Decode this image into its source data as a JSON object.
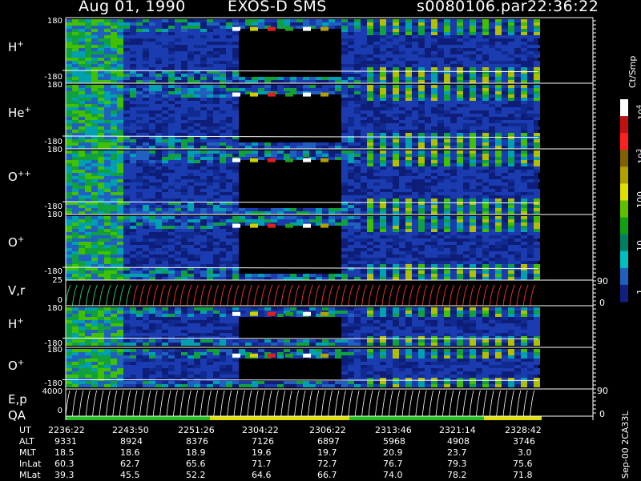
{
  "header": {
    "date": "Aug 01, 1990",
    "instrument": "EXOS-D SMS",
    "file": "s0080106.par",
    "time": "22:36:22"
  },
  "panels": [
    {
      "label": "H",
      "sup": "+",
      "ymax": "180",
      "ymin": "-180"
    },
    {
      "label": "He",
      "sup": "+",
      "ymax": "180",
      "ymin": "-180"
    },
    {
      "label": "O",
      "sup": "++",
      "ymax": "180",
      "ymin": "-180"
    },
    {
      "label": "O",
      "sup": "+",
      "ymax": "180",
      "ymin": "-180"
    },
    {
      "label": "V,r",
      "sup": "",
      "ymax": "25",
      "ymin": "0",
      "rmax": "90",
      "rmin": "0"
    },
    {
      "label": "H",
      "sup": "+",
      "ymax": "180",
      "ymin": "-180"
    },
    {
      "label": "O",
      "sup": "+",
      "ymax": "180",
      "ymin": "-180"
    },
    {
      "label": "E,p",
      "sup": "",
      "label2": "QA",
      "ymax": "4000",
      "ymin": "0",
      "rmax": "90",
      "rmin": "0"
    }
  ],
  "colorbar": {
    "title": "Ct/Smp",
    "labels": [
      "10^4",
      "10^3",
      "100",
      "10",
      "1"
    ],
    "colors": [
      "#ffffff",
      "#c01010",
      "#ff2020",
      "#806000",
      "#b0a000",
      "#e0e000",
      "#60c000",
      "#10a010",
      "#008060",
      "#00c0c0",
      "#2060c0",
      "#102080"
    ]
  },
  "time_table": {
    "rows": [
      {
        "name": "UT",
        "values": [
          "2236:22",
          "2243:50",
          "2251:26",
          "2304:22",
          "2306:22",
          "2313:46",
          "2321:14",
          "2328:42"
        ]
      },
      {
        "name": "ALT",
        "values": [
          "9331",
          "8924",
          "8376",
          "7126",
          "6897",
          "5968",
          "4908",
          "3746"
        ]
      },
      {
        "name": "MLT",
        "values": [
          "18.5",
          "18.6",
          "18.9",
          "19.6",
          "19.7",
          "20.9",
          "23.7",
          "3.0"
        ]
      },
      {
        "name": "InLat",
        "values": [
          "60.3",
          "62.7",
          "65.6",
          "71.7",
          "72.7",
          "76.7",
          "79.3",
          "75.6"
        ]
      },
      {
        "name": "MLat",
        "values": [
          "39.3",
          "45.5",
          "52.2",
          "64.6",
          "66.7",
          "74.0",
          "78.2",
          "71.8"
        ]
      }
    ]
  },
  "stamp": "Sep-00 2CA33L",
  "chart_data": {
    "type": "heatmap",
    "title": "Aug 01, 1990 EXOS-D SMS",
    "xlabel": "UT",
    "x_ticks": [
      "2236:22",
      "2243:50",
      "2251:26",
      "2304:22",
      "2306:22",
      "2313:46",
      "2321:14",
      "2328:42"
    ],
    "panels": [
      "H+",
      "He+",
      "O++",
      "O+",
      "V,r",
      "H+",
      "O+",
      "E,p / QA"
    ],
    "ylim_pitch": [
      -180,
      180
    ],
    "colorbar_unit": "Ct/Smp",
    "colorbar_scale": "log",
    "colorbar_range": [
      1,
      10000
    ]
  }
}
